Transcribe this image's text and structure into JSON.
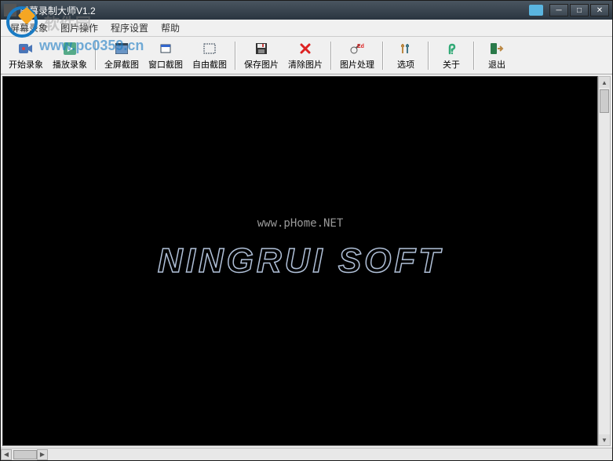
{
  "watermark": {
    "text": "软件园",
    "url": "www.pc0359.cn"
  },
  "window": {
    "title": "屏幕录制大师V1.2"
  },
  "menu": {
    "items": [
      "屏幕录象",
      "图片操作",
      "程序设置",
      "帮助"
    ]
  },
  "toolbar": {
    "items": [
      {
        "label": "开始录象",
        "icon": "record"
      },
      {
        "label": "播放录象",
        "icon": "play"
      },
      {
        "label": "全屏截图",
        "icon": "fullscreen"
      },
      {
        "label": "窗口截图",
        "icon": "window"
      },
      {
        "label": "自由截图",
        "icon": "free"
      },
      {
        "label": "保存图片",
        "icon": "save"
      },
      {
        "label": "清除图片",
        "icon": "clear"
      },
      {
        "label": "图片处理",
        "icon": "edit"
      },
      {
        "label": "选项",
        "icon": "options"
      },
      {
        "label": "关于",
        "icon": "about"
      },
      {
        "label": "退出",
        "icon": "exit"
      }
    ]
  },
  "splash": {
    "url": "www.pHome.NET",
    "brand": "NINGRUI SOFT"
  }
}
